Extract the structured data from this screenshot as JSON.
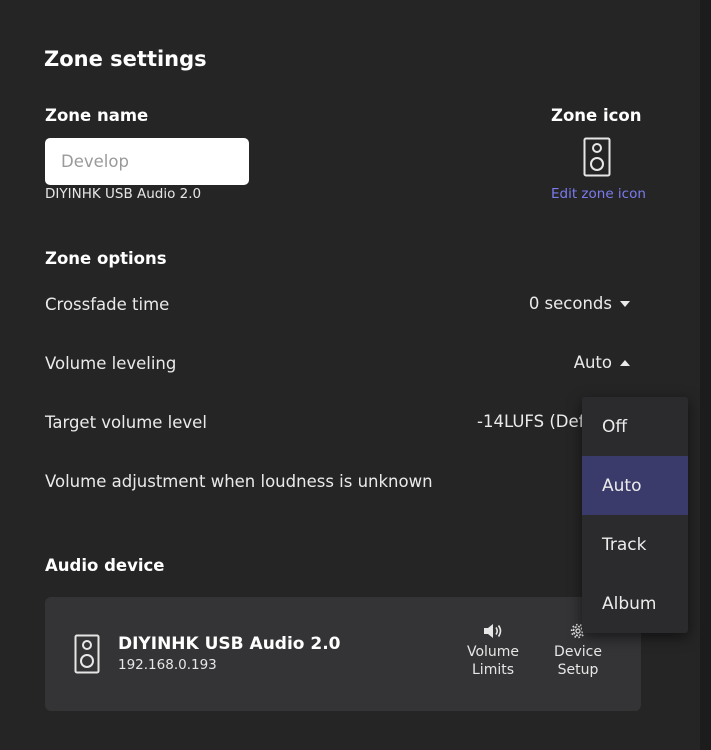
{
  "header": {
    "title": "Zone settings"
  },
  "zone_name": {
    "label": "Zone name",
    "value": "",
    "placeholder": "Develop",
    "device_name": "DIYINHK USB Audio 2.0"
  },
  "zone_icon": {
    "label": "Zone icon",
    "icon": "speaker-icon",
    "edit_label": "Edit zone icon"
  },
  "zone_options": {
    "heading": "Zone options",
    "crossfade": {
      "label": "Crossfade time",
      "value": "0 seconds"
    },
    "volume_leveling": {
      "label": "Volume leveling",
      "value": "Auto"
    },
    "target_volume": {
      "label": "Target volume level",
      "value": "-14LUFS (Def"
    },
    "volume_adjustment": {
      "label": "Volume adjustment when loudness is unknown"
    }
  },
  "dropdown": {
    "options": [
      "Off",
      "Auto",
      "Track",
      "Album"
    ],
    "selected": "Auto"
  },
  "audio_device": {
    "heading": "Audio device",
    "name": "DIYINHK USB Audio 2.0",
    "ip": "192.168.0.193",
    "volume_limits_line1": "Volume",
    "volume_limits_line2": "Limits",
    "device_setup_line1": "Device",
    "device_setup_line2": "Setup"
  },
  "colors": {
    "background": "#252526",
    "accent_link": "#7b7bf0",
    "selected_option": "#3b3b6b",
    "card": "#343436"
  }
}
